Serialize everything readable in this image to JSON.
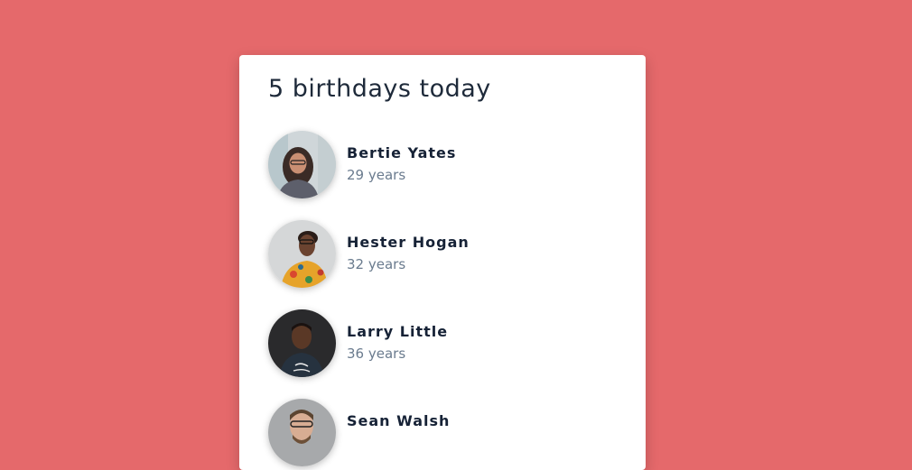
{
  "colors": {
    "background": "#e5696b",
    "card": "#ffffff",
    "name_text": "#162236",
    "age_text": "#6a7b8e"
  },
  "card": {
    "title": "5 birthdays today"
  },
  "people": [
    {
      "name": "Bertie Yates",
      "age": "29 years",
      "avatar_icon": "person-photo-icon"
    },
    {
      "name": "Hester Hogan",
      "age": "32 years",
      "avatar_icon": "person-photo-icon"
    },
    {
      "name": "Larry Little",
      "age": "36 years",
      "avatar_icon": "person-photo-icon"
    },
    {
      "name": "Sean Walsh",
      "age": "",
      "avatar_icon": "person-photo-icon"
    }
  ]
}
